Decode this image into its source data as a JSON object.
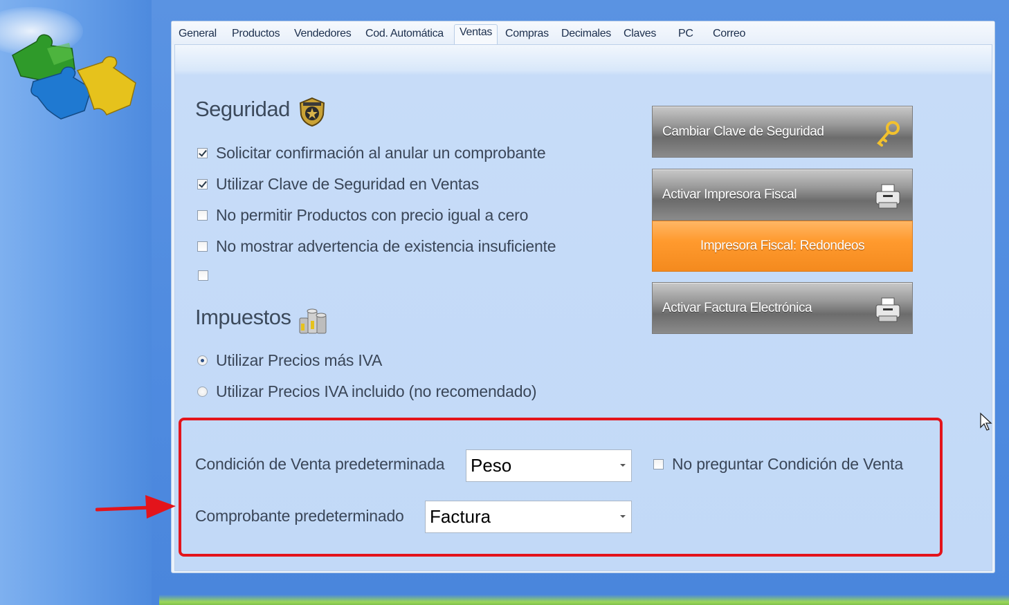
{
  "tabs": [
    "General",
    "Productos",
    "Vendedores",
    "Cod. Automática",
    "Ventas",
    "Compras",
    "Decimales",
    "Claves",
    "PC",
    "Correo"
  ],
  "active_tab": "Ventas",
  "seguridad": {
    "title": "Seguridad",
    "icon": "security-badge-icon",
    "options": [
      {
        "label": "Solicitar confirmación al anular un comprobante",
        "checked": true
      },
      {
        "label": "Utilizar Clave de Seguridad en Ventas",
        "checked": true
      },
      {
        "label": "No permitir Productos con precio igual a cero",
        "checked": false
      },
      {
        "label": "No mostrar advertencia de existencia insuficiente",
        "checked": false
      },
      {
        "label": "",
        "checked": false
      }
    ]
  },
  "impuestos": {
    "title": "Impuestos",
    "icon": "coins-icon",
    "options": [
      {
        "label": "Utilizar Precios más IVA",
        "selected": true
      },
      {
        "label": "Utilizar Precios IVA incluido (no recomendado)",
        "selected": false
      }
    ]
  },
  "buttons": {
    "change_key": "Cambiar Clave de Seguridad",
    "fiscal_printer": "Activar Impresora Fiscal",
    "fiscal_rounding": "Impresora Fiscal: Redondeos",
    "e_invoice": "Activar Factura Electrónica"
  },
  "defaults": {
    "condition_label": "Condición de Venta predeterminada",
    "condition_value": "Peso",
    "no_ask_label": "No preguntar Condición de Venta",
    "no_ask_checked": false,
    "voucher_label": "Comprobante predeterminado",
    "voucher_value": "Factura"
  },
  "colors": {
    "highlight": "#e3141b",
    "accent_orange": "#ff9a2e",
    "background": "#5a93e2"
  }
}
